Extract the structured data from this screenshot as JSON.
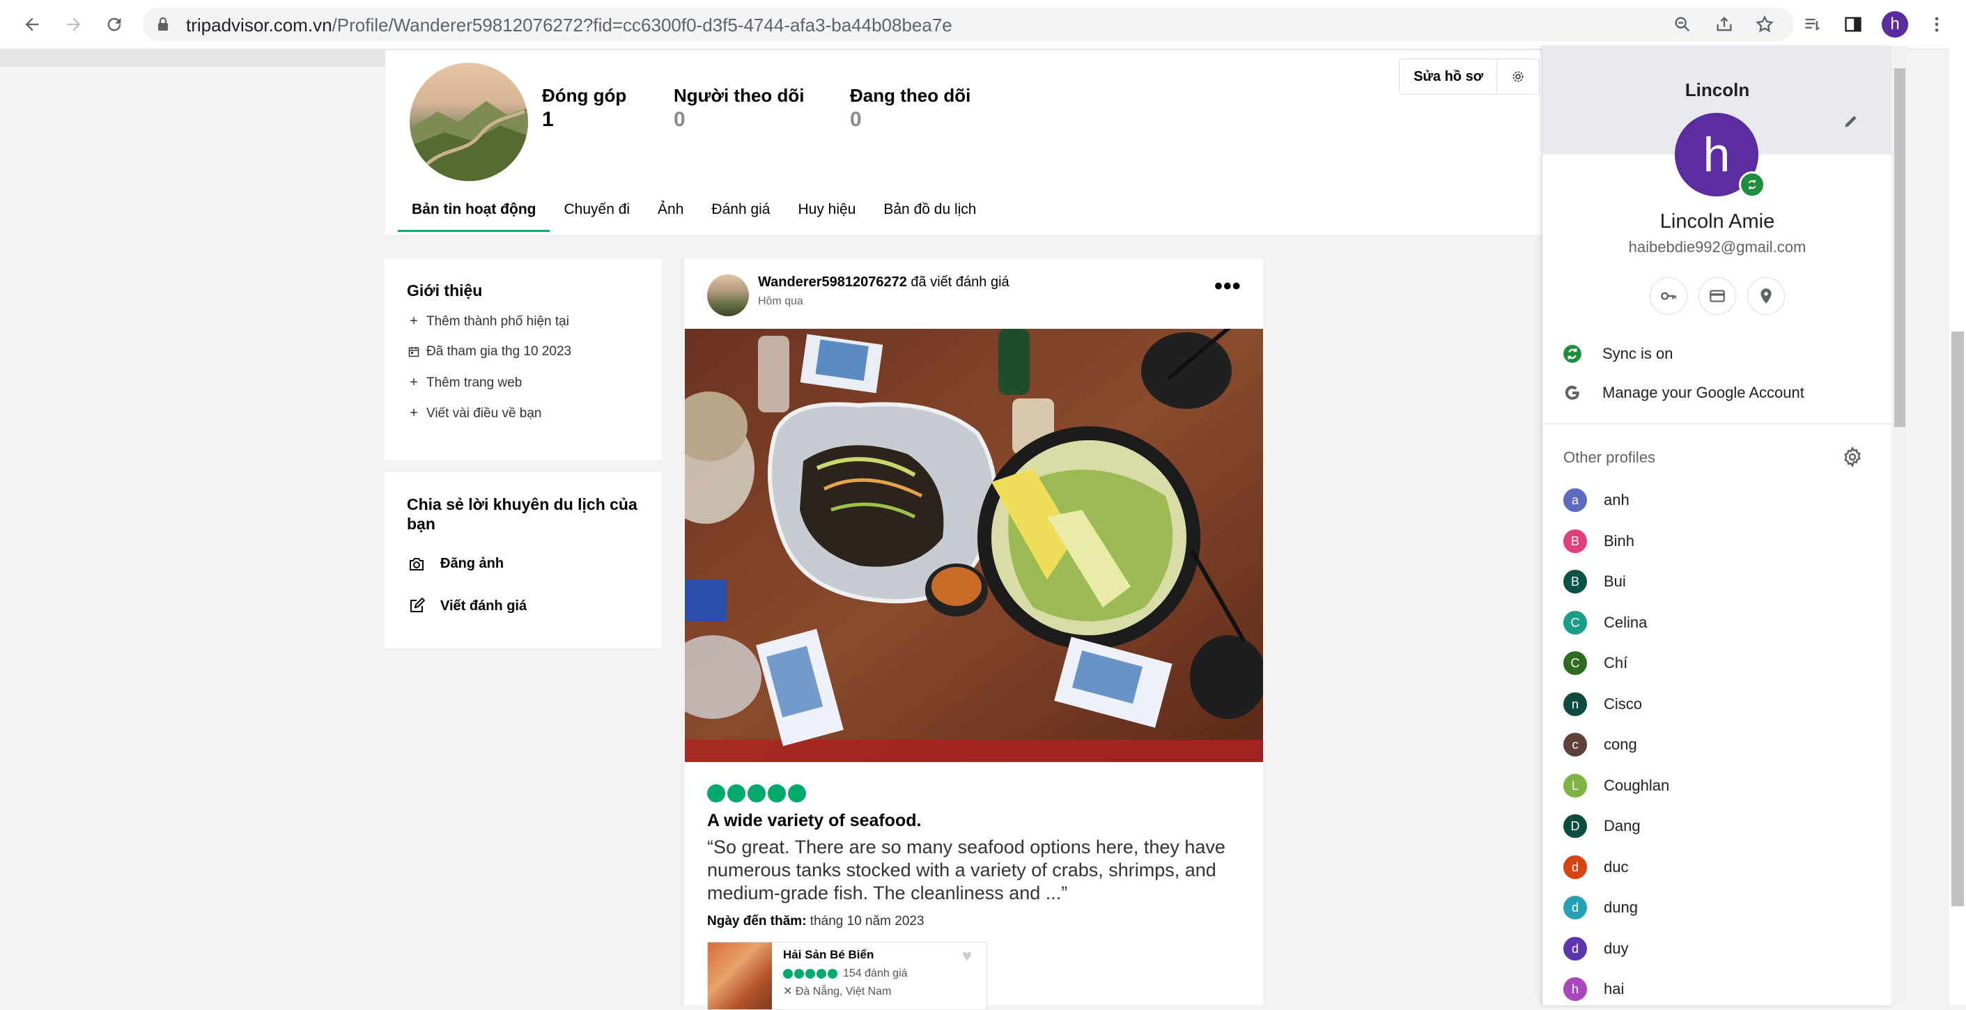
{
  "browser": {
    "url_host": "tripadvisor.com.vn",
    "url_path": "/Profile/Wanderer59812076272?fid=cc6300f0-d3f5-4744-afa3-ba44b08bea7e",
    "avatar_letter": "h"
  },
  "profile": {
    "stats": [
      {
        "label": "Đóng góp",
        "value": "1"
      },
      {
        "label": "Người theo dõi",
        "value": "0"
      },
      {
        "label": "Đang theo dõi",
        "value": "0"
      }
    ],
    "edit_label": "Sửa hồ sơ",
    "tabs": [
      "Bản tin hoạt động",
      "Chuyến đi",
      "Ảnh",
      "Đánh giá",
      "Huy hiệu",
      "Bản đồ du lịch"
    ]
  },
  "intro": {
    "title": "Giới thiệu",
    "items": [
      "Thêm thành phố hiện tại",
      "Đã tham gia thg 10 2023",
      "Thêm trang web",
      "Viết vài điều về bạn"
    ]
  },
  "share": {
    "title": "Chia sẻ lời khuyên du lịch của bạn",
    "photo_label": "Đăng ảnh",
    "review_label": "Viết đánh giá"
  },
  "post": {
    "author": "Wanderer59812076272",
    "action": " đã viết đánh giá",
    "time": "Hôm qua",
    "rating": 5,
    "title": "A wide variety of seafood.",
    "text": "“So great. There are so many seafood options here, they have numerous tanks stocked with a variety of crabs, shrimps, and medium-grade fish. The cleanliness and ...”",
    "visit_label": "Ngày đến thăm:",
    "visit_value": " tháng 10 năm 2023",
    "place": {
      "name": "Hải Sản Bé Biển",
      "rating": 5,
      "reviews": "154 đánh giá",
      "location": "Đà Nẵng, Việt Nam"
    }
  },
  "google_panel": {
    "name_top": "Lincoln",
    "avatar_letter": "h",
    "full_name": "Lincoln Amie",
    "email": "haibebdie992@gmail.com",
    "sync_label": "Sync is on",
    "manage_label": "Manage your Google Account",
    "other_title": "Other profiles",
    "profiles": [
      {
        "letter": "a",
        "name": "anh",
        "color": "#5c6bc0"
      },
      {
        "letter": "B",
        "name": "Binh",
        "color": "#e0407b"
      },
      {
        "letter": "B",
        "name": "Bui",
        "color": "#0b5345"
      },
      {
        "letter": "C",
        "name": "Celina",
        "color": "#1a9e8a"
      },
      {
        "letter": "C",
        "name": "Chí",
        "color": "#2e6b1e"
      },
      {
        "letter": "n",
        "name": "Cisco",
        "color": "#0d4a40"
      },
      {
        "letter": "c",
        "name": "cong",
        "color": "#5d4037"
      },
      {
        "letter": "L",
        "name": "Coughlan",
        "color": "#7cb342"
      },
      {
        "letter": "D",
        "name": "Dang",
        "color": "#0b4d3f"
      },
      {
        "letter": "d",
        "name": "duc",
        "color": "#d84315"
      },
      {
        "letter": "d",
        "name": "dung",
        "color": "#26a0b5"
      },
      {
        "letter": "d",
        "name": "duy",
        "color": "#5e35b1"
      },
      {
        "letter": "h",
        "name": "hai",
        "color": "#ab47bc"
      }
    ]
  }
}
